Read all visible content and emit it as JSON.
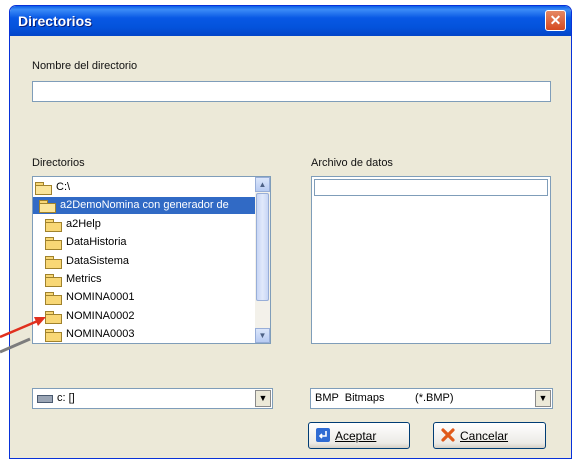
{
  "window": {
    "title": "Directorios",
    "close_glyph": "✕"
  },
  "nombre": {
    "label": "Nombre del directorio",
    "value": ""
  },
  "directorios": {
    "label": "Directorios",
    "items": [
      {
        "label": "C:\\",
        "icon": "open-folder-icon",
        "selected": false
      },
      {
        "label": "a2DemoNomina con generador de",
        "icon": "open-folder-icon",
        "selected": true
      },
      {
        "label": "a2Help",
        "icon": "folder-icon",
        "selected": false
      },
      {
        "label": "DataHistoria",
        "icon": "folder-icon",
        "selected": false
      },
      {
        "label": "DataSistema",
        "icon": "folder-icon",
        "selected": false
      },
      {
        "label": "Metrics",
        "icon": "folder-icon",
        "selected": false
      },
      {
        "label": "NOMINA0001",
        "icon": "folder-icon",
        "selected": false
      },
      {
        "label": "NOMINA0002",
        "icon": "folder-icon",
        "selected": false
      },
      {
        "label": "NOMINA0003",
        "icon": "folder-icon",
        "selected": false
      }
    ]
  },
  "archivo": {
    "label": "Archivo de datos",
    "value": ""
  },
  "drive": {
    "value": "c: []"
  },
  "filetype": {
    "value": "BMP  Bitmaps          (*.BMP)"
  },
  "buttons": {
    "aceptar": "Aceptar",
    "cancelar": "Cancelar"
  },
  "colors": {
    "accent": "#316ac5",
    "annotation_arrow": "#e0301e"
  }
}
